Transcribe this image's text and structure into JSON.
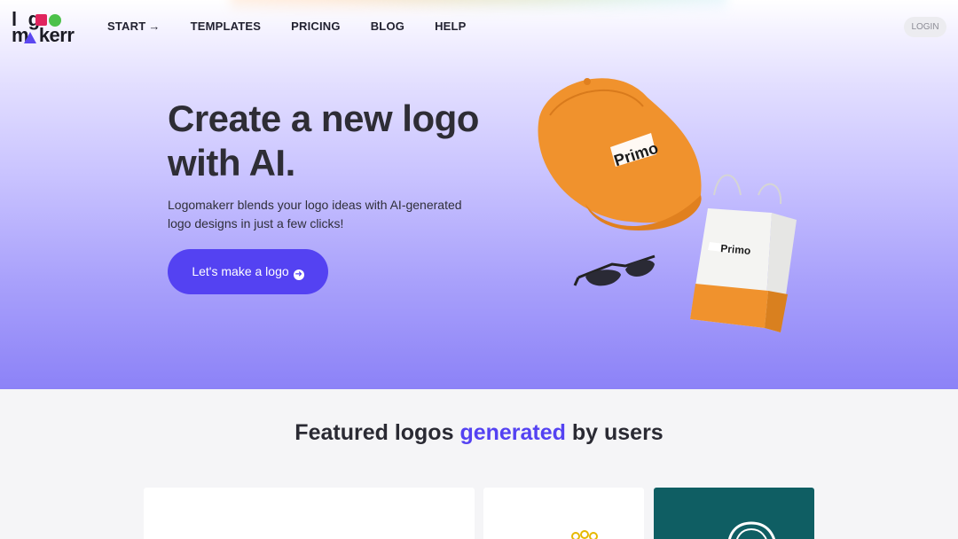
{
  "nav": {
    "logo_line1": "logo",
    "logo_line2": "makerr",
    "items": [
      {
        "label": "START",
        "arrow": "→"
      },
      {
        "label": "TEMPLATES"
      },
      {
        "label": "PRICING"
      },
      {
        "label": "BLOG"
      },
      {
        "label": "HELP"
      }
    ],
    "login_label": "LOGIN"
  },
  "hero": {
    "headline": "Create a new logo with AI.",
    "subtext": "Logomakerr blends your logo ideas with AI-generated logo designs in just a few clicks!",
    "cta_label": "Let's make a logo",
    "product_brand": "Primo"
  },
  "featured": {
    "title_before": "Featured logos ",
    "title_highlight": "generated",
    "title_after": " by users"
  },
  "colors": {
    "accent": "#5442f2",
    "logo_red": "#e0245e",
    "logo_green": "#4cc14a",
    "cap_orange": "#f0922d",
    "card_teal": "#0f5e63"
  }
}
